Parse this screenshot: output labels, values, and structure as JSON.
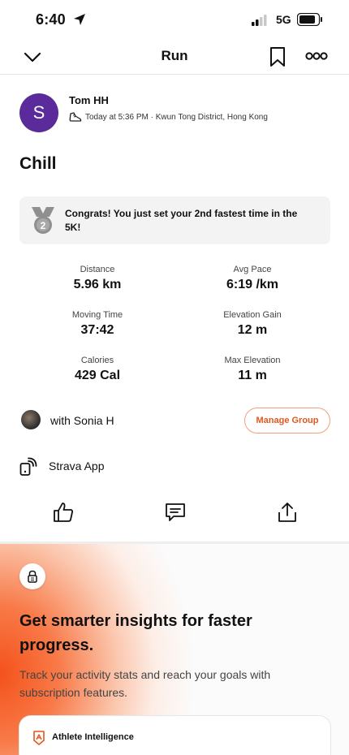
{
  "status_bar": {
    "time": "6:40",
    "network": "5G"
  },
  "nav": {
    "title": "Run"
  },
  "header": {
    "avatar_initial": "S",
    "athlete_name": "Tom HH",
    "meta": "Today at 5:36 PM · Kwun Tong District, Hong Kong"
  },
  "activity": {
    "title": "Chill"
  },
  "achievement": {
    "text": "Congrats! You just set your 2nd fastest time in the 5K!"
  },
  "stats": [
    {
      "label": "Distance",
      "value": "5.96 km"
    },
    {
      "label": "Avg Pace",
      "value": "6:19 /km"
    },
    {
      "label": "Moving Time",
      "value": "37:42"
    },
    {
      "label": "Elevation Gain",
      "value": "12 m"
    },
    {
      "label": "Calories",
      "value": "429 Cal"
    },
    {
      "label": "Max Elevation",
      "value": "11 m"
    }
  ],
  "group": {
    "with_text": "with Sonia H",
    "manage_label": "Manage Group"
  },
  "device": {
    "name": "Strava App"
  },
  "actions": {
    "icons": [
      "thumbs-up-icon",
      "comment-icon",
      "share-icon"
    ]
  },
  "promo": {
    "headline": "Get smarter insights for faster progress.",
    "body": "Track your activity stats and reach your goals with subscription features.",
    "card_title": "Athlete Intelligence"
  },
  "colors": {
    "brand": "#fc4c02",
    "avatar": "#5b2a9b",
    "achievement_bg": "#f3f3f3"
  }
}
